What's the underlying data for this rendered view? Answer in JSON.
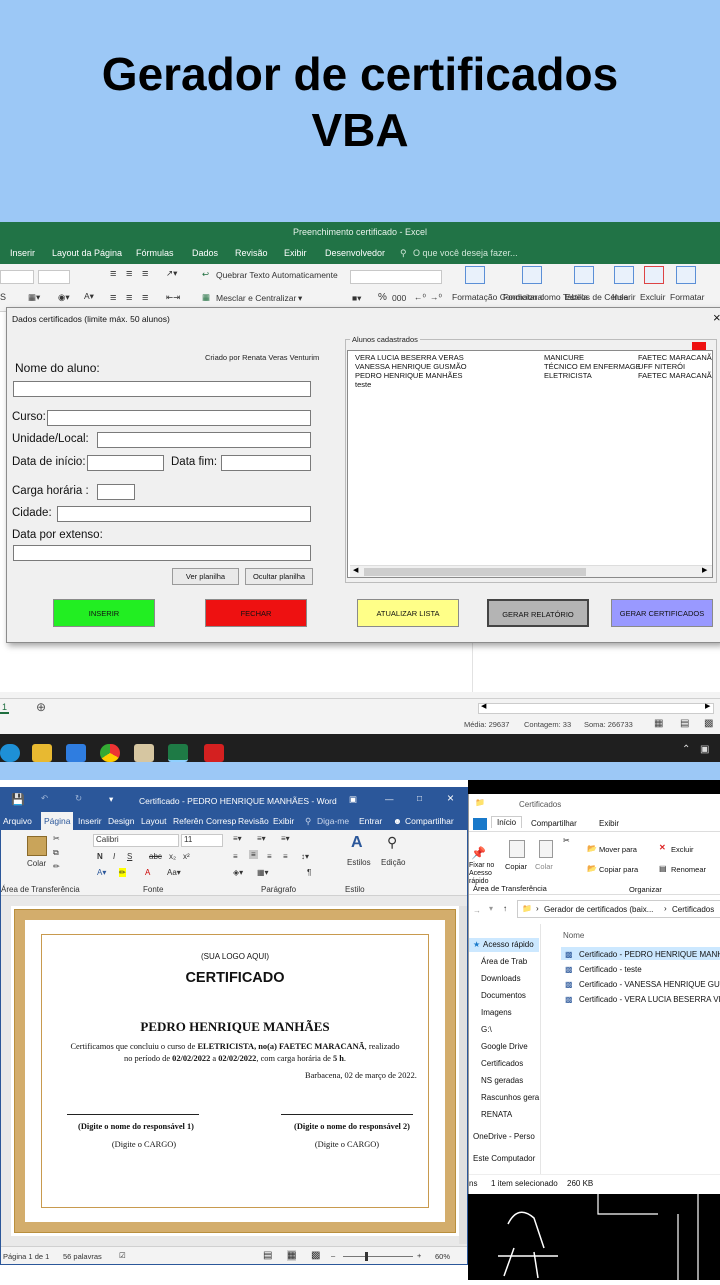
{
  "banner": {
    "title_line1": "Gerador de certificados",
    "title_line2": "VBA"
  },
  "excel": {
    "title": "Preenchimento certificado - Excel",
    "menu": [
      "Inserir",
      "Layout da Página",
      "Fórmulas",
      "Dados",
      "Revisão",
      "Exibir",
      "Desenvolvedor",
      "O que você deseja fazer..."
    ],
    "ribbon": {
      "wrap_text": "Quebrar Texto Automaticamente",
      "merge_center": "Mesclar e Centralizar",
      "cond_format": "Formatação Condicional",
      "format_table": "Formatar como Tabela",
      "cell_styles": "Estilos de Célula",
      "insert": "Inserir",
      "delete": "Excluir",
      "format": "Formatar",
      "percent": "%",
      "thousands": "000"
    },
    "sheet_tab": "1",
    "status": {
      "media": "Média: 29637",
      "contagem": "Contagem: 33",
      "soma": "Soma: 266733"
    }
  },
  "form": {
    "title": "Dados certificados (limite máx. 50 alunos)",
    "credit": "Criado por Renata Veras Venturim",
    "labels": {
      "nome": "Nome do aluno:",
      "curso": "Curso:",
      "unidade": "Unidade/Local:",
      "data_inicio": "Data de início:",
      "data_fim": "Data fim:",
      "carga": "Carga horária :",
      "cidade": "Cidade:",
      "data_extenso": "Data por extenso:"
    },
    "buttons": {
      "ver_planilha": "Ver planilha",
      "ocultar_planilha": "Ocultar planilha",
      "inserir": "INSERIR",
      "fechar": "FECHAR",
      "atualizar": "ATUALIZAR LISTA",
      "relatorio": "GERAR RELATÓRIO",
      "certificados": "GERAR CERTIFICADOS"
    },
    "list_title": "Alunos cadastrados",
    "students": [
      {
        "nome": "VERA LUCIA BESERRA VERAS",
        "curso": "MANICURE",
        "local": "FAETEC MARACANÃ"
      },
      {
        "nome": "VANESSA HENRIQUE GUSMÃO",
        "curso": "TÉCNICO EM ENFERMAGE",
        "local": "UFF NITERÓI"
      },
      {
        "nome": "PEDRO HENRIQUE MANHÃES",
        "curso": "ELETRICISTA",
        "local": "FAETEC MARACANÃ"
      },
      {
        "nome": "teste",
        "curso": "",
        "local": ""
      }
    ],
    "colors": {
      "inserir": "#22ee22",
      "fechar": "#ee1111",
      "atualizar": "#ffff88",
      "relatorio": "#b4b4b4",
      "certificados": "#9999ff"
    }
  },
  "word": {
    "title": "Certificado - PEDRO HENRIQUE MANHÃES - Word",
    "tabs": [
      "Arquivo",
      "Página",
      "Inserir",
      "Design",
      "Layout",
      "Referên",
      "Corresp",
      "Revisão",
      "Exibir",
      "Diga-me",
      "Entrar",
      "Compartilhar"
    ],
    "ribbon": {
      "paste": "Colar",
      "clipboard": "Área de Transferência",
      "font_name": "Calibri",
      "font_size": "11",
      "font": "Fonte",
      "paragraph": "Parágrafo",
      "styles": "Estilos",
      "style_group": "Estilo",
      "editing": "Edição"
    },
    "cert": {
      "logo": "(SUA LOGO AQUI)",
      "heading": "CERTIFICADO",
      "name": "PEDRO HENRIQUE MANHÃES",
      "line1_pre": "Certificamos que concluiu o curso de",
      "line1_course": "ELETRICISTA",
      "line1_mid": ", no(a)",
      "line1_place": "FAETEC MARACANÃ",
      "line1_post": ", realizado",
      "line2_pre": "no período de",
      "date_start": "02/02/2022",
      "line2_a": "a",
      "date_end": "02/02/2022",
      "line2_mid": ", com carga horária de",
      "hours": "5 h",
      "place_date": "Barbacena, 02 de março de 2022.",
      "resp1": "(Digite o nome do responsável 1)",
      "cargo1": "(Digite o CARGO)",
      "resp2": "(Digite o nome do responsável 2)",
      "cargo2": "(Digite o CARGO)"
    },
    "status": {
      "page": "Página 1 de 1",
      "words": "56 palavras",
      "zoom": "60%"
    }
  },
  "explorer": {
    "title": "Certificados",
    "tabs": [
      "Início",
      "Compartilhar",
      "Exibir"
    ],
    "ribbon": {
      "pin": "Fixar no Acesso rápido",
      "copy": "Copiar",
      "paste": "Colar",
      "clipboard": "Área de Transferência",
      "move_to": "Mover para",
      "copy_to": "Copiar para",
      "delete": "Excluir",
      "rename": "Renomear",
      "organize": "Organizar"
    },
    "breadcrumb": [
      "Gerador de certificados (baix...",
      "Certificados"
    ],
    "column_name": "Nome",
    "nav": [
      "Acesso rápido",
      "Área de Trab",
      "Downloads",
      "Documentos",
      "Imagens",
      "G:\\",
      "Google Drive",
      "Certificados",
      "NS geradas",
      "Rascunhos gera",
      "RENATA",
      "OneDrive - Perso",
      "Este Computador"
    ],
    "files": [
      "Certificado - PEDRO HENRIQUE MANH",
      "Certificado - teste",
      "Certificado - VANESSA HENRIQUE GUS",
      "Certificado - VERA LUCIA BESERRA VER"
    ],
    "status_items": "ns",
    "status_selected": "1 item selecionado",
    "status_size": "260 KB"
  }
}
